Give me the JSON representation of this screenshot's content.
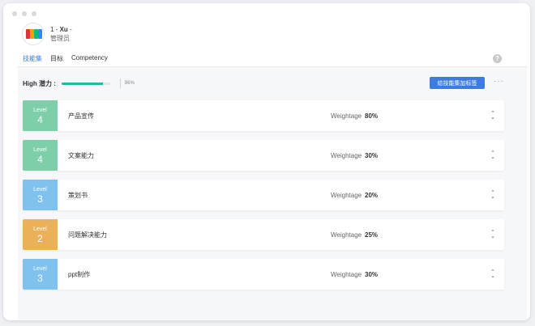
{
  "profile": {
    "prefix": "1 - ",
    "name": "Xu",
    "suffix": " -",
    "role": "管理员"
  },
  "tabs": [
    {
      "label": "技能集",
      "active": true
    },
    {
      "label": "目标",
      "active": false
    },
    {
      "label": "Competency",
      "active": false
    }
  ],
  "help_label": "?",
  "potential": {
    "label": "High 潜力 :",
    "value_text": "86%",
    "value": 86
  },
  "tag_button_label": "给技能集加标签",
  "more_label": "···",
  "weight_label": "Weightage",
  "level_word": "Level",
  "chevron_up": "⌃",
  "chevron_down": "⌄",
  "skills": [
    {
      "level": "4",
      "name": "产品宣传",
      "weight": "80%",
      "color": "#7ccfa8"
    },
    {
      "level": "4",
      "name": "文案能力",
      "weight": "30%",
      "color": "#7ccfa8"
    },
    {
      "level": "3",
      "name": "策划书",
      "weight": "20%",
      "color": "#7fc2ee"
    },
    {
      "level": "2",
      "name": "问题解决能力",
      "weight": "25%",
      "color": "#ebb05a"
    },
    {
      "level": "3",
      "name": "ppt制作",
      "weight": "30%",
      "color": "#7fc2ee"
    }
  ]
}
